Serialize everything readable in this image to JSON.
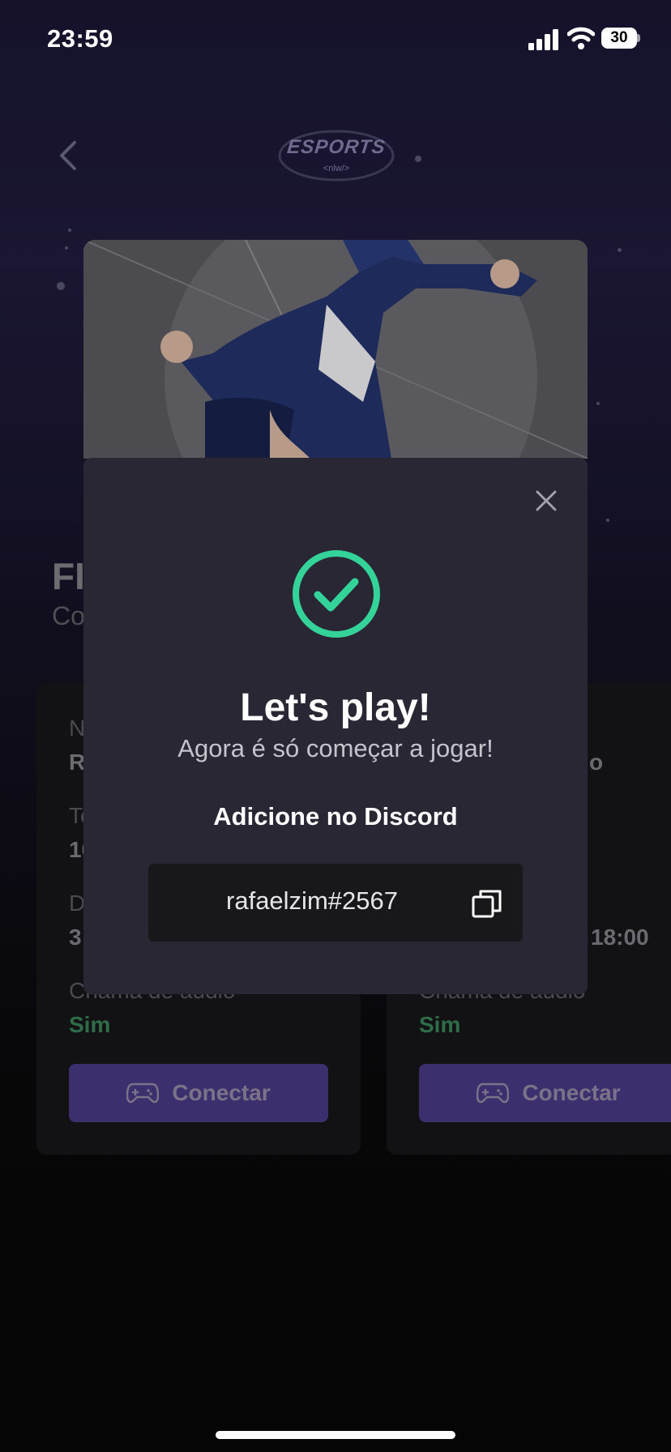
{
  "status_bar": {
    "time": "23:59",
    "battery": "30"
  },
  "header": {
    "logo_text": "ESPORTS",
    "logo_sub": "<nlw/>"
  },
  "game": {
    "title_partial": "FI",
    "subtitle_partial": "Co"
  },
  "cards": [
    {
      "name_label_partial": "N",
      "name_value_partial": "R",
      "time_label_partial": "Te",
      "time_value_partial": "10",
      "days_label_partial": "D",
      "days_value_partial": "3",
      "audio_label": "Chama de áudio",
      "audio_value": "Sim",
      "button_label": "Conectar"
    },
    {
      "name_value_partial": "o",
      "hours_value_partial": "18:00",
      "audio_label": "Chama de áudio",
      "audio_value": "Sim",
      "button_label": "Conectar"
    }
  ],
  "modal": {
    "title": "Let's play!",
    "subtitle": "Agora é só começar a jogar!",
    "discord_label": "Adicione no Discord",
    "discord_tag": "rafaelzim#2567"
  },
  "colors": {
    "success": "#34d399",
    "modal_bg": "#2a2734",
    "button_purple": "#8b5cf6"
  }
}
